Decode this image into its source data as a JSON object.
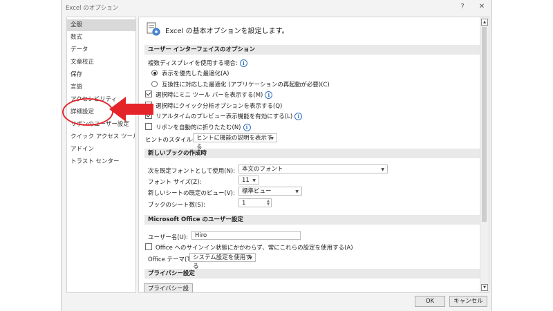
{
  "window": {
    "title": "Excel のオプション",
    "help_glyph": "?",
    "close_glyph": "✕"
  },
  "sidebar": {
    "items": [
      {
        "label": "全般"
      },
      {
        "label": "数式"
      },
      {
        "label": "データ"
      },
      {
        "label": "文章校正"
      },
      {
        "label": "保存"
      },
      {
        "label": "言語"
      },
      {
        "label": "アクセシビリティ"
      },
      {
        "label": "詳細設定"
      },
      {
        "label": "リボンのユーザー設定"
      },
      {
        "label": "クイック アクセス ツール バー"
      },
      {
        "label": "アドイン"
      },
      {
        "label": "トラスト センター"
      }
    ],
    "selected": "全般"
  },
  "header": {
    "text": "Excel の基本オプションを設定します。"
  },
  "ui_section": {
    "title": "ユーザー インターフェイスのオプション",
    "multi_display_label": "複数ディスプレイを使用する場合:",
    "radio_optimize_display": "表示を優先した最適化(A)",
    "radio_optimize_compat": "互換性に対応した最適化 (アプリケーションの再起動が必要)(C)",
    "chk_mini_toolbar": "選択時にミニ ツール バーを表示する(M)",
    "chk_quick_analysis": "選択時にクイック分析オプションを表示する(Q)",
    "chk_live_preview": "リアルタイムのプレビュー表示機能を有効にする(L)",
    "chk_collapse_ribbon": "リボンを自動的に折りたたむ(N)",
    "tooltip_style_label": "ヒントのスタイル(R):",
    "tooltip_style_value": "ヒントに機能の説明を表示する"
  },
  "new_workbook_section": {
    "title": "新しいブックの作成時",
    "default_font_label": "次を既定フォントとして使用(N):",
    "default_font_value": "本文のフォント",
    "font_size_label": "フォント サイズ(Z):",
    "font_size_value": "11",
    "default_view_label": "新しいシートの既定のビュー(V):",
    "default_view_value": "標準ビュー",
    "sheet_count_label": "ブックのシート数(S):",
    "sheet_count_value": "1"
  },
  "office_section": {
    "title": "Microsoft Office のユーザー設定",
    "username_label": "ユーザー名(U):",
    "username_value": "Hiro",
    "chk_always_use": "Office へのサインイン状態にかかわらず、常にこれらの設定を使用する(A)",
    "theme_label": "Office テーマ(T):",
    "theme_value": "システム設定を使用する"
  },
  "privacy_section": {
    "title": "プライバシー設定",
    "button_label": "プライバシー設定..."
  },
  "footer": {
    "ok_label": "OK",
    "cancel_label": "キャンセル"
  },
  "annotation": {
    "highlight_color": "#e5242a",
    "target": "詳細設定"
  },
  "colors": {
    "info_blue": "#2e6fc0",
    "selected_bg": "#d9d9d9",
    "section_bg": "#e9e9e9"
  }
}
